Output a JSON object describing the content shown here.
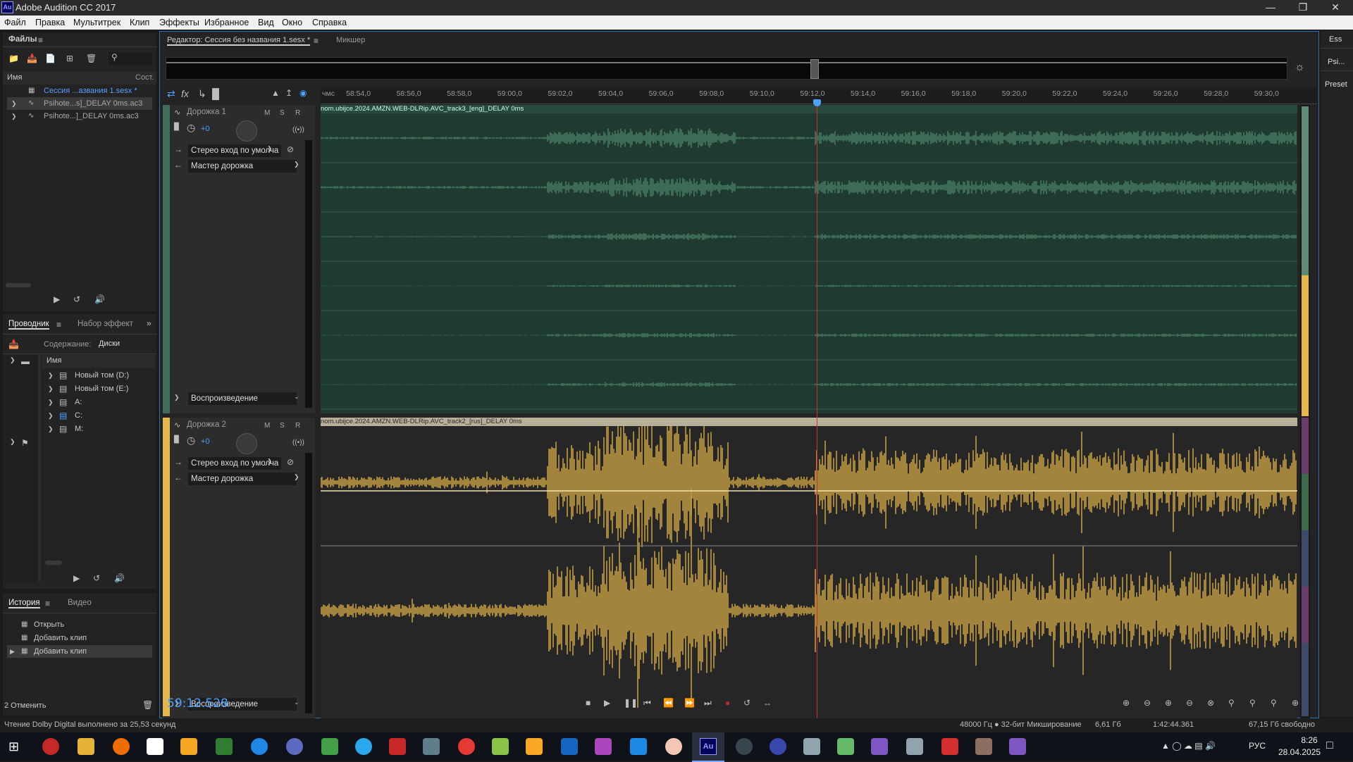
{
  "window": {
    "title": "Adobe Audition CC 2017",
    "logo_text": "Au"
  },
  "menu": [
    "Файл",
    "Правка",
    "Мультитрек",
    "Клип",
    "Эффекты",
    "Избранное",
    "Вид",
    "Окно",
    "Справка"
  ],
  "files_panel": {
    "title": "Файлы",
    "col_name": "Имя",
    "col_status": "Сост.",
    "items": [
      {
        "label": "Сессия ...азвания 1.sesx *"
      },
      {
        "label": "Psihote...s]_DELAY 0ms.ac3"
      },
      {
        "label": "Psihote...]_DELAY 0ms.ac3"
      }
    ]
  },
  "explorer_panel": {
    "tab_explorer": "Проводник",
    "tab_effects": "Набор эффект",
    "content_label": "Содержание:",
    "content_value": "Диски",
    "col_name": "Имя",
    "drives": [
      "Новый том (D:)",
      "Новый том (E:)",
      "A:",
      "C:",
      "M:"
    ]
  },
  "history_panel": {
    "tab_history": "История",
    "tab_video": "Видео",
    "items": [
      "Открыть",
      "Добавить клип",
      "Добавить клип"
    ],
    "undo_count": "2 Отменить"
  },
  "editor": {
    "tab_editor": "Редактор: Сессия без названия 1.sesx *",
    "tab_mixer": "Микшер",
    "ruler_unit": "чмс",
    "ruler_ticks": [
      "58:54,0",
      "58:56,0",
      "58:58,0",
      "59:00,0",
      "59:02,0",
      "59:04,0",
      "59:06,0",
      "59:08,0",
      "59:10,0",
      "59:12,0",
      "59:14,0",
      "59:16,0",
      "59:18,0",
      "59:20,0",
      "59:22,0",
      "59:24,0",
      "59:26,0",
      "59:28,0",
      "59:30,0"
    ],
    "playhead_position": 0.508
  },
  "tracks": [
    {
      "name": "Дорожка 1",
      "volume": "+0",
      "input": "Стерео вход по умолча",
      "output": "Мастер дорожка",
      "mode": "Воспроизведение",
      "clip_label": "nom.ubijce.2024.AMZN.WEB-DLRip.AVC_track3_[eng]_DELAY 0ms",
      "color": "#3d6f5a"
    },
    {
      "name": "Дорожка 2",
      "volume": "+0",
      "input": "Стерео вход по умолча",
      "output": "Мастер дорожка",
      "mode": "Воспроизведение",
      "clip_label": "nom.ubijce.2024.AMZN.WEB-DLRip.AVC_track2_[rus]_DELAY 0ms",
      "color": "#e6b84a"
    }
  ],
  "transport": {
    "time": "59:12.528"
  },
  "right_panel": {
    "items": [
      "Ess",
      "Psi...",
      "Preset"
    ]
  },
  "status_bar": {
    "left": "Чтение Dolby Digital выполнено за 25,53 секунд",
    "format": "48000 Гц ● 32-бит Микширование",
    "size": "6,61 Гб",
    "duration": "1:42:44.361",
    "free": "67,15 Гб свободно"
  },
  "taskbar": {
    "lang": "РУС",
    "time": "8:26",
    "date": "28.04.2025"
  }
}
